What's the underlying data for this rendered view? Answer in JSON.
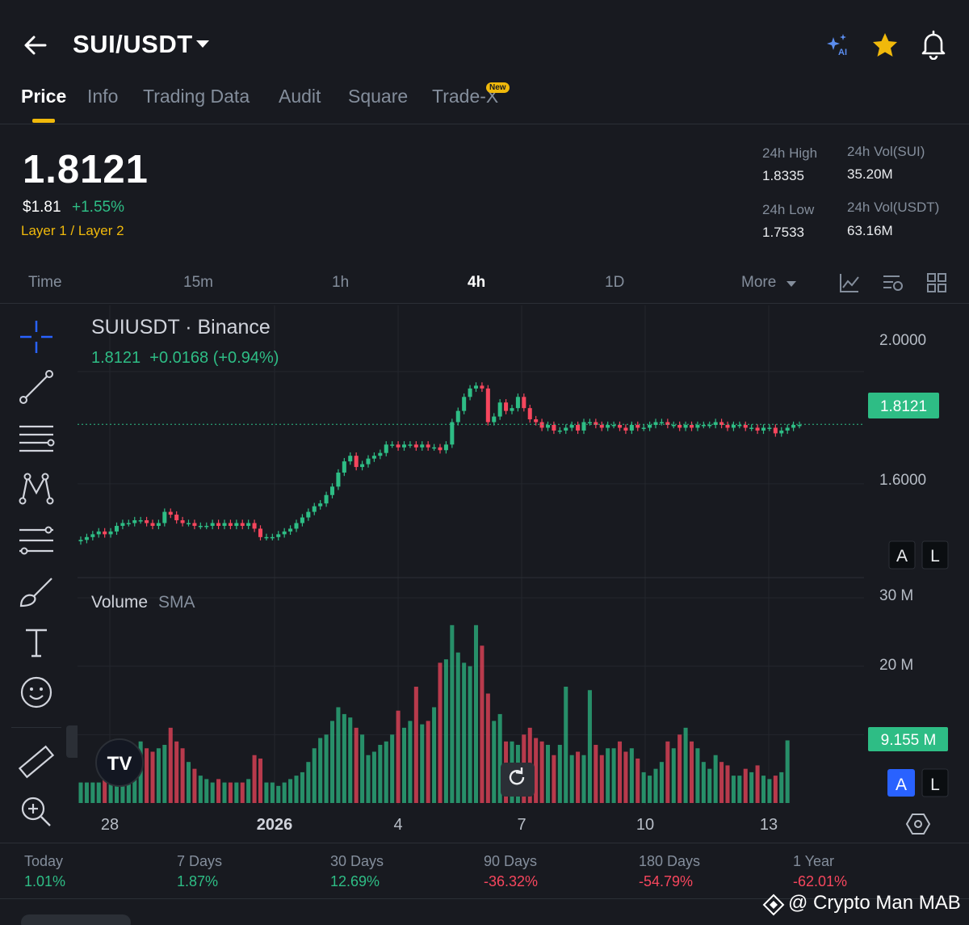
{
  "header": {
    "pair": "SUI/USDT",
    "tabs": [
      {
        "label": "Price"
      },
      {
        "label": "Info"
      },
      {
        "label": "Trading Data"
      },
      {
        "label": "Audit"
      },
      {
        "label": "Square"
      },
      {
        "label": "Trade-X"
      }
    ],
    "new_badge": "New"
  },
  "ticker": {
    "last_price": "1.8121",
    "usd_price": "$1.81",
    "change_pct": "+1.55%",
    "category": "Layer 1 / Layer 2",
    "high_label": "24h High",
    "high_value": "1.8335",
    "low_label": "24h Low",
    "low_value": "1.7533",
    "vol_base_label": "24h Vol(SUI)",
    "vol_base_value": "35.20M",
    "vol_quote_label": "24h Vol(USDT)",
    "vol_quote_value": "63.16M"
  },
  "intervals": {
    "items": [
      "Time",
      "15m",
      "1h",
      "4h",
      "1D"
    ],
    "active": "4h",
    "more": "More"
  },
  "chart": {
    "title": "SUIUSDT · Binance",
    "ohlc_line": "1.8121  +0.0168 (+0.94%)",
    "volume_title": "Volume",
    "volume_suffix": "SMA",
    "current_price_tag": "1.8121",
    "current_volume_tag": "9.155 M",
    "price_ticks": [
      "2.0000",
      "1.6000"
    ],
    "volume_ticks": [
      "30 M",
      "20 M"
    ],
    "x_ticks": [
      "28",
      "2026",
      "4",
      "7",
      "10",
      "13"
    ],
    "scale_buttons": {
      "auto": "A",
      "log": "L"
    },
    "logo": "TV",
    "colors": {
      "up": "#2ebd85",
      "down": "#f6465d",
      "accent": "#f0b90b",
      "bg": "#181a20"
    }
  },
  "chart_data": {
    "type": "candlestick",
    "title": "SUIUSDT · Binance",
    "x_ticks": [
      "28",
      "2026",
      "4",
      "7",
      "10",
      "13"
    ],
    "ylim": [
      1.3,
      2.15
    ],
    "y_ticks": [
      2.0,
      1.6
    ],
    "volume_ylim": [
      0,
      32
    ],
    "volume_unit": "M",
    "closes": [
      1.4,
      1.41,
      1.42,
      1.43,
      1.42,
      1.43,
      1.45,
      1.46,
      1.46,
      1.47,
      1.47,
      1.46,
      1.45,
      1.46,
      1.5,
      1.49,
      1.47,
      1.46,
      1.46,
      1.45,
      1.45,
      1.45,
      1.46,
      1.45,
      1.46,
      1.45,
      1.46,
      1.45,
      1.46,
      1.44,
      1.41,
      1.41,
      1.41,
      1.42,
      1.43,
      1.44,
      1.46,
      1.48,
      1.5,
      1.52,
      1.53,
      1.56,
      1.59,
      1.64,
      1.68,
      1.7,
      1.66,
      1.67,
      1.69,
      1.7,
      1.71,
      1.74,
      1.74,
      1.73,
      1.74,
      1.74,
      1.73,
      1.74,
      1.73,
      1.73,
      1.72,
      1.74,
      1.82,
      1.86,
      1.91,
      1.94,
      1.95,
      1.94,
      1.82,
      1.84,
      1.89,
      1.86,
      1.87,
      1.91,
      1.87,
      1.83,
      1.82,
      1.8,
      1.81,
      1.79,
      1.79,
      1.8,
      1.81,
      1.79,
      1.82,
      1.82,
      1.81,
      1.8,
      1.81,
      1.81,
      1.8,
      1.79,
      1.81,
      1.8,
      1.8,
      1.81,
      1.82,
      1.82,
      1.81,
      1.81,
      1.8,
      1.81,
      1.8,
      1.81,
      1.81,
      1.81,
      1.82,
      1.81,
      1.8,
      1.81,
      1.81,
      1.8,
      1.8,
      1.79,
      1.8,
      1.8,
      1.78,
      1.79,
      1.8,
      1.81,
      1.81
    ],
    "volumes": [
      3,
      3,
      3,
      3,
      3.5,
      3.5,
      4,
      4,
      4.5,
      6,
      9,
      8,
      7.5,
      8,
      8.5,
      11,
      9,
      8,
      6,
      5,
      4,
      3.5,
      3,
      3.5,
      3,
      3,
      3,
      3,
      3.5,
      7,
      6.5,
      3,
      3,
      2.5,
      3,
      3.5,
      4,
      4.5,
      6,
      8,
      9.5,
      10,
      12,
      14,
      13,
      12.5,
      11,
      10,
      7,
      7.5,
      8.5,
      9,
      10,
      13.5,
      11,
      12,
      17,
      11.5,
      12,
      14,
      20.5,
      21,
      26,
      22,
      20.5,
      20,
      26,
      23,
      16,
      12,
      13,
      9,
      9,
      8.5,
      10,
      11,
      9.5,
      9,
      8.5,
      7,
      8.5,
      17,
      7,
      7.5,
      7,
      16.5,
      8.5,
      7,
      8,
      8,
      9,
      7.5,
      8,
      6.5,
      4.5,
      4,
      5,
      6,
      9,
      8,
      10,
      11,
      9,
      8,
      6,
      5,
      7,
      6,
      5.5,
      4,
      4,
      5,
      4.5,
      5.5,
      4,
      3.5,
      4,
      4.5,
      9.155
    ],
    "last_price": 1.8121,
    "last_volume_m": 9.155
  },
  "tools": [
    "crosshair",
    "trend-line",
    "horizontal-lines",
    "pattern",
    "fib",
    "brush",
    "text",
    "emoji",
    "ruler",
    "zoom"
  ],
  "performance": [
    {
      "label": "Today",
      "value": "1.01%",
      "dir": "up"
    },
    {
      "label": "7 Days",
      "value": "1.87%",
      "dir": "up"
    },
    {
      "label": "30 Days",
      "value": "12.69%",
      "dir": "up"
    },
    {
      "label": "90 Days",
      "value": "-36.32%",
      "dir": "down"
    },
    {
      "label": "180 Days",
      "value": "-54.79%",
      "dir": "down"
    },
    {
      "label": "1 Year",
      "value": "-62.01%",
      "dir": "down"
    }
  ],
  "watermark": "@ Crypto Man MAB"
}
